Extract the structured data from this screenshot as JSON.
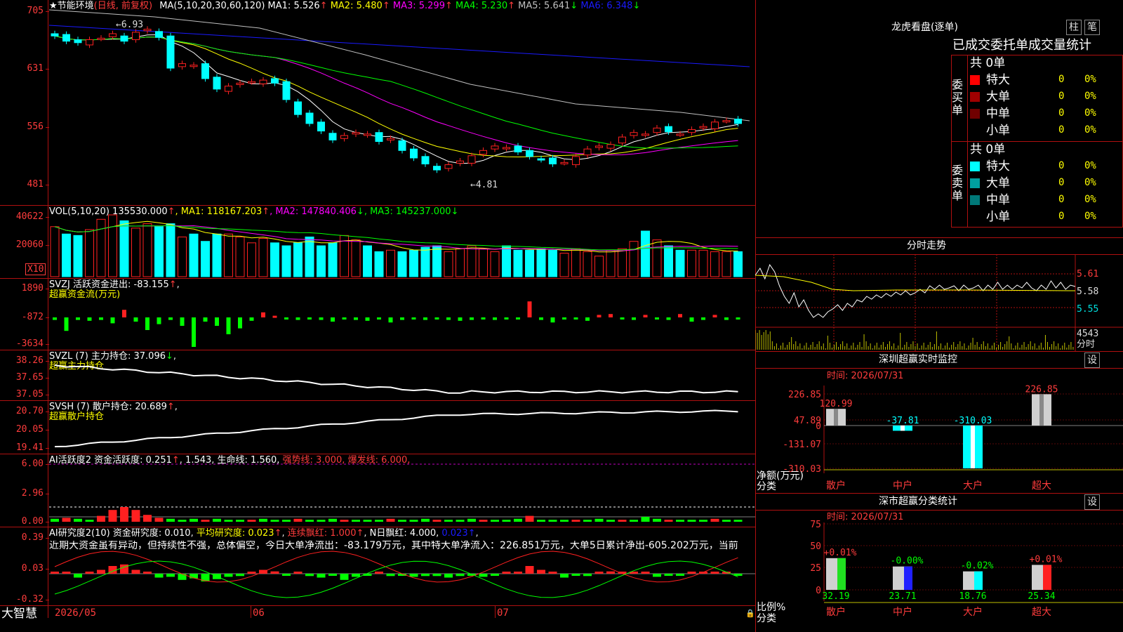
{
  "stock": {
    "title": "节能环境",
    "period": "(日线, 前复权)"
  },
  "ma_label": "MA(5,10,20,30,60,120)",
  "ma_values": [
    {
      "name": "MA1",
      "value": "5.526",
      "arrow": "↑",
      "color": "#ffffff"
    },
    {
      "name": "MA2",
      "value": "5.480",
      "arrow": "↑",
      "color": "#ffff00"
    },
    {
      "name": "MA3",
      "value": "5.299",
      "arrow": "↑",
      "color": "#ff00ff"
    },
    {
      "name": "MA4",
      "value": "5.230",
      "arrow": "↑",
      "color": "#00ff00"
    },
    {
      "name": "MA5",
      "value": "5.641",
      "arrow": "↓",
      "color": "#c0c0c0"
    },
    {
      "name": "MA6",
      "value": "6.348",
      "arrow": "↓",
      "color": "#1a1aff"
    }
  ],
  "main_axis": [
    "705",
    "631",
    "556",
    "481"
  ],
  "annotations": {
    "high": "6.93",
    "low": "←4.81"
  },
  "vol": {
    "label": "VOL(5,10,20)",
    "value": "135530.000",
    "arrow": "↑",
    "mas": [
      {
        "name": "MA1",
        "value": "118167.203",
        "arrow": "↑",
        "color": "#ffff00"
      },
      {
        "name": "MA2",
        "value": "147840.406",
        "arrow": "↓",
        "color": "#ff00ff"
      },
      {
        "name": "MA3",
        "value": "145237.000",
        "arrow": "↓",
        "color": "#00ff00"
      }
    ],
    "axis": [
      "40622",
      "20060"
    ],
    "unit": "X10"
  },
  "svzj": {
    "label": "SVZJ  活跃资金进出:",
    "value": "-83.155",
    "arrow": "↑",
    "sub": "超赢资金流(万元)",
    "axis": [
      "1890",
      "-872",
      "-3634"
    ]
  },
  "svzl": {
    "label": "SVZL (7) 主力持仓:",
    "value": "37.096",
    "arrow": "↓",
    "sub": "超赢主力持仓",
    "axis": [
      "38.26",
      "37.65",
      "37.05"
    ]
  },
  "svsh": {
    "label": "SVSH (7) 散户持仓:",
    "value": "20.689",
    "arrow": "↑",
    "sub": "超赢散户持仓",
    "axis": [
      "20.70",
      "20.05",
      "19.41"
    ]
  },
  "ai1": {
    "label": "AI活跃度2 资金活跃度:",
    "v1": "0.251",
    "v2": "1.543",
    "life": "生命线: 1.560,",
    "strong": "强势线: 3.000,",
    "burst": "爆发线: 6.000,",
    "axis": [
      "6.00",
      "2.96",
      "0.00"
    ]
  },
  "ai2": {
    "label": "AI研究度2(10) 资金研究度:",
    "v1": "0.010",
    "avg": "平均研究度: 0.023",
    "cont": "连续飘红: 1.000",
    "nday": "N日飘红: 4.000,",
    "v2": "0.023",
    "axis": [
      "0.39",
      "0.03",
      "-0.32"
    ],
    "comment": "近期大资金虽有异动，但持续性不强，总体偏空，今日大单净流出：-83.179万元，其中特大单净流入：226.851万元，大单5日累计净出-605.202万元，当前"
  },
  "dates": [
    "2026/05",
    "06",
    "07"
  ],
  "brand": "大智慧",
  "lhb": {
    "title": "龙虎看盘(逐单)",
    "btn1": "柱",
    "btn2": "笔",
    "header": "已成交委托单成交量统计",
    "buy_label": "委买单",
    "sell_label": "委卖单",
    "buy_total": "共 0单",
    "sell_total": "共 0单",
    "buy_rows": [
      {
        "label": "特大",
        "count": "0",
        "pct": "0%",
        "color": "#ff0000"
      },
      {
        "label": "大单",
        "count": "0",
        "pct": "0%",
        "color": "#a00000"
      },
      {
        "label": "中单",
        "count": "0",
        "pct": "0%",
        "color": "#700000"
      },
      {
        "label": "小单",
        "count": "0",
        "pct": "0%",
        "color": "#000000"
      }
    ],
    "sell_rows": [
      {
        "label": "特大",
        "count": "0",
        "pct": "0%",
        "color": "#00ffff"
      },
      {
        "label": "大单",
        "count": "0",
        "pct": "0%",
        "color": "#00a0a0"
      },
      {
        "label": "中单",
        "count": "0",
        "pct": "0%",
        "color": "#007878"
      },
      {
        "label": "小单",
        "count": "0",
        "pct": "0%",
        "color": "#000000"
      }
    ]
  },
  "intraday": {
    "title": "分时走势",
    "axis": [
      "5.61",
      "5.58",
      "5.55"
    ],
    "vol": "4543",
    "vol_unit": "分时"
  },
  "monitor": {
    "title": "深圳超赢实时监控",
    "btn": "设",
    "time": "时间: 2026/07/31",
    "axis": [
      "226.85",
      "47.89",
      "0",
      "-131.07",
      "-310.03"
    ],
    "ylabel": "净额(万元)",
    "xlabel": "分类",
    "cats": [
      "散户",
      "中户",
      "大户",
      "超大"
    ],
    "values": [
      120.99,
      -37.81,
      -310.03,
      226.85
    ]
  },
  "stats": {
    "title": "深市超赢分类统计",
    "btn": "设",
    "time": "时间: 2026/07/31",
    "axis": [
      "75",
      "50",
      "25",
      "0"
    ],
    "ylabel": "比例%",
    "xlabel": "分类",
    "cats": [
      "散户",
      "中户",
      "大户",
      "超大"
    ],
    "deltas": [
      "+0.01%",
      "-0.00%",
      "-0.02%",
      "+0.01%"
    ],
    "values": [
      32.19,
      23.71,
      18.76,
      25.34
    ],
    "colors": [
      "#20e020",
      "#2020ff",
      "#00ffff",
      "#ff2020"
    ]
  },
  "chart_data": {
    "type": "candlestick",
    "title": "节能环境 (日线, 前复权)",
    "ylim": [
      4.81,
      6.93
    ],
    "x_ticks": [
      "2026/05",
      "06",
      "07"
    ],
    "close": [
      6.75,
      6.68,
      6.66,
      6.7,
      6.72,
      6.78,
      6.68,
      6.8,
      6.84,
      6.73,
      6.32,
      6.38,
      6.36,
      6.18,
      6.04,
      6.08,
      6.12,
      6.14,
      6.16,
      6.12,
      5.9,
      5.7,
      5.58,
      5.48,
      5.36,
      5.42,
      5.46,
      5.44,
      5.34,
      5.38,
      5.22,
      5.12,
      5.04,
      4.96,
      5.03,
      5.08,
      5.15,
      5.22,
      5.28,
      5.26,
      5.2,
      5.14,
      5.1,
      5.04,
      5.06,
      5.14,
      5.24,
      5.28,
      5.3,
      5.4,
      5.46,
      5.44,
      5.52,
      5.47,
      5.44,
      5.5,
      5.54,
      5.6,
      5.62,
      5.58
    ],
    "volume": [
      34000,
      29000,
      28000,
      32000,
      39000,
      42000,
      38000,
      33000,
      36000,
      34000,
      36000,
      27000,
      29000,
      24000,
      29000,
      29000,
      27000,
      23000,
      26000,
      23000,
      21000,
      23000,
      27000,
      21000,
      23000,
      28000,
      25000,
      21000,
      17000,
      18000,
      17000,
      18000,
      20000,
      21000,
      17000,
      19000,
      21000,
      19000,
      17000,
      21000,
      18000,
      18000,
      19000,
      18000,
      16000,
      19000,
      17000,
      14000,
      18000,
      19000,
      24000,
      31000,
      25000,
      21000,
      18000,
      18000,
      18000,
      17000,
      17000,
      17000
    ]
  }
}
